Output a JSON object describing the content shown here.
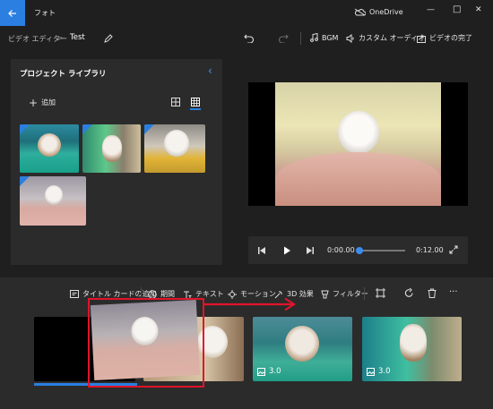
{
  "titlebar": {
    "app_title": "フォト",
    "onedrive": "OneDrive",
    "minimize": "—",
    "maximize": "□",
    "close": "✕"
  },
  "editor": {
    "breadcrumb_root": "ビデオ エディター",
    "breadcrumb_sep": ">",
    "project_name": "Test",
    "toolbar": {
      "bgm": "BGM",
      "custom_audio": "カスタム オーディオ",
      "finish_video": "ビデオの完了"
    }
  },
  "library": {
    "title": "プロジェクト ライブラリ",
    "add_label": "追加",
    "collapse_glyph": "‹"
  },
  "player": {
    "current_time": "0:00.00",
    "total_time": "0:12.00",
    "progress": 0.0
  },
  "storyboard": {
    "tools": {
      "title_card": "タイトル カードの追加",
      "duration": "期間",
      "text": "テキスト",
      "motion": "モーション",
      "effects_3d": "3D 効果",
      "filters": "フィルター",
      "more": "···"
    },
    "clips": [
      {
        "duration": ""
      },
      {
        "duration": ""
      },
      {
        "duration": "3.0"
      },
      {
        "duration": "3.0"
      }
    ]
  },
  "colors": {
    "accent": "#2a7fe0",
    "selection_box": "#e0142a",
    "arrow": "#e0142a"
  }
}
